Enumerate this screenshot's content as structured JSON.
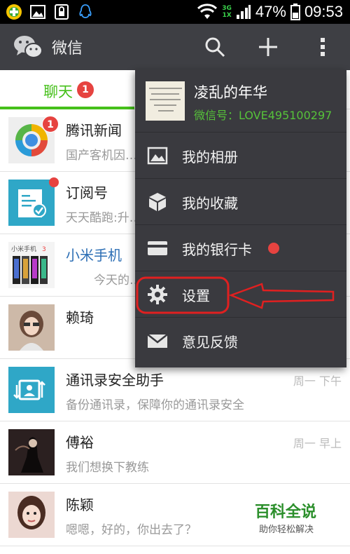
{
  "status_bar": {
    "network": "3G",
    "network_sub": "1X",
    "battery": "47%",
    "time": "09:53",
    "icons": [
      "game-app-icon",
      "gallery-icon",
      "lock-icon",
      "qq-icon",
      "wifi-icon",
      "signal-icon",
      "battery-icon"
    ]
  },
  "action_bar": {
    "title": "微信",
    "icons": [
      "wechat-logo-icon",
      "search-icon",
      "plus-icon",
      "more-icon"
    ]
  },
  "tabs": {
    "chat_label": "聊天",
    "chat_badge": "1",
    "accent": "#45c01a"
  },
  "chats": [
    {
      "name": "腾讯新闻",
      "msg": "国产客机因…",
      "badge": "1",
      "time": ""
    },
    {
      "name": "订阅号",
      "msg": "天天酷跑:升…",
      "dot": true,
      "time": ""
    },
    {
      "name": "小米手机",
      "msg": "今天的…",
      "time": ""
    },
    {
      "name": "赖琦",
      "msg": "",
      "time": ""
    },
    {
      "name": "通讯录安全助手",
      "msg": "备份通讯录，保障你的通讯录安全",
      "time": "周一 下午"
    },
    {
      "name": "傅裕",
      "msg": "我们想换下教练",
      "time": "周一 早上"
    },
    {
      "name": "陈颖",
      "msg": "嗯嗯，好的，你出去了？",
      "time": ""
    }
  ],
  "menu": {
    "profile_name": "凌乱的年华",
    "profile_id": "微信号：LOVE495100297",
    "items": [
      {
        "label": "我的相册",
        "icon": "photo-album-icon"
      },
      {
        "label": "我的收藏",
        "icon": "favorites-box-icon"
      },
      {
        "label": "我的银行卡",
        "icon": "bank-card-icon",
        "dot": true
      },
      {
        "label": "设置",
        "icon": "gear-icon"
      },
      {
        "label": "意见反馈",
        "icon": "envelope-icon"
      }
    ]
  },
  "watermark": {
    "title": "百科全说",
    "subtitle": "助你轻松解决"
  },
  "colors": {
    "action_bar": "#3e3f44",
    "menu_bg": "#3a3a3f",
    "badge_red": "#e64340",
    "annotation_red": "#e02020"
  }
}
